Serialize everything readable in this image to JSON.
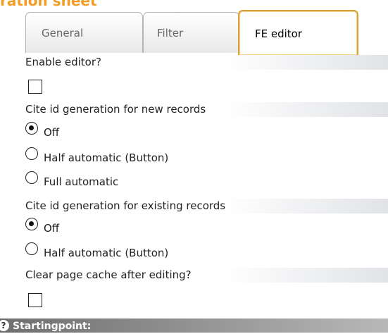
{
  "header": {
    "title": "ration sheet"
  },
  "tabs": [
    {
      "label": "General",
      "active": false
    },
    {
      "label": "Filter",
      "active": false
    },
    {
      "label": "FE editor",
      "active": true
    }
  ],
  "form": {
    "enable_editor": {
      "label": "Enable editor?",
      "checked": false
    },
    "cite_new": {
      "label": "Cite id generation for new records",
      "options": [
        {
          "label": "Off",
          "selected": true
        },
        {
          "label": "Half automatic (Button)",
          "selected": false
        },
        {
          "label": "Full automatic",
          "selected": false
        }
      ]
    },
    "cite_existing": {
      "label": "Cite id generation for existing records",
      "options": [
        {
          "label": "Off",
          "selected": true
        },
        {
          "label": "Half automatic (Button)",
          "selected": false
        }
      ]
    },
    "clear_cache": {
      "label": "Clear page cache after editing?",
      "checked": false
    }
  },
  "bottom_bar": {
    "label": "Startingpoint:",
    "icon": "help-icon"
  },
  "colors": {
    "accent": "#f49b22",
    "active_tab_border": "#d8a13a"
  }
}
